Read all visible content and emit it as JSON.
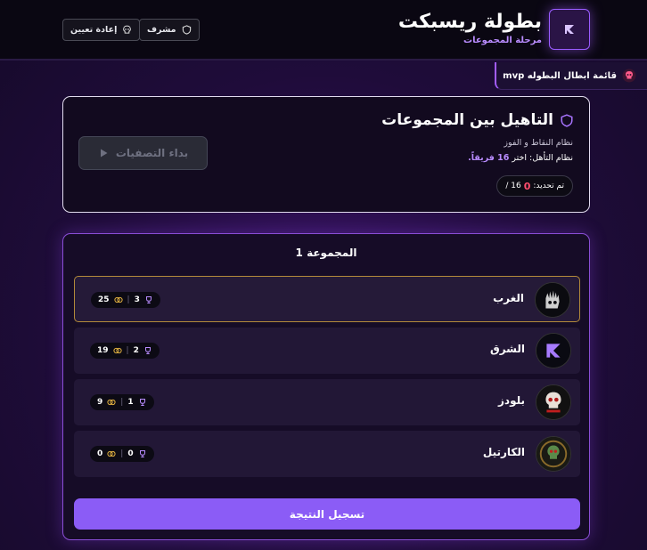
{
  "header": {
    "title": "بطولة ريسبكت",
    "subtitle": "مرحلة المجموعات",
    "admin_label": "مشرف",
    "reset_label": "إعادة تعيين"
  },
  "mvp_tab": {
    "label": "قائمة ابطال البطوله mvp"
  },
  "qualification": {
    "title": "التاهيل بين المجموعات",
    "system_line": "نظام النقاط و الفوز",
    "qual_prefix": "نظام التأهل: اختر",
    "qual_highlight": "16 فريقاً.",
    "selected_label": "تم تحديد:",
    "selected_count": "0",
    "selected_total": "/ 16",
    "start_button": "بداء التصفيات"
  },
  "group": {
    "title": "المجموعة 1",
    "teams": [
      {
        "name": "الغرب",
        "wins": "3",
        "points": "25",
        "avatar": "skull-hand-icon"
      },
      {
        "name": "الشرق",
        "wins": "2",
        "points": "19",
        "avatar": "k-logo-icon"
      },
      {
        "name": "بلودز",
        "wins": "1",
        "points": "9",
        "avatar": "skull-logo-icon"
      },
      {
        "name": "الكارتيل",
        "wins": "0",
        "points": "0",
        "avatar": "cartel-skull-icon"
      }
    ],
    "submit_label": "تسجيل النتيجة"
  },
  "colors": {
    "accent": "#8b5cf6",
    "highlight": "#b98cff",
    "danger": "#ff4d6d",
    "gold": "#e0b040"
  }
}
